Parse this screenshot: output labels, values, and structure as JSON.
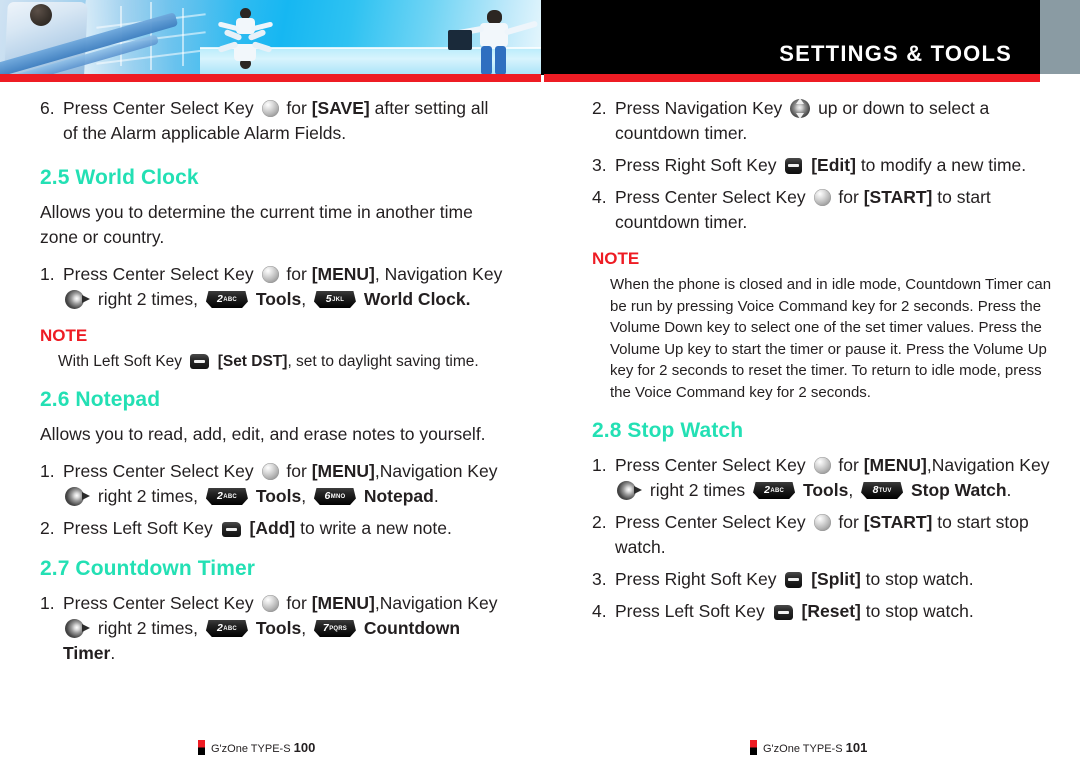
{
  "header": {
    "title": "SETTINGS & TOOLS",
    "accent_red": "#ee1c24",
    "black": "#000000",
    "gray_block": "#8a9ba3"
  },
  "theme": {
    "section_heading_color": "#23e0b4",
    "note_color": "#ee1c24",
    "body_color": "#231f20"
  },
  "left_column": {
    "item6": {
      "num": "6.",
      "t1": "Press Center Select Key",
      "icon1": "center-select-key",
      "t2": "for",
      "b1": "[SAVE]",
      "t3": "after setting all of the Alarm applicable Alarm Fields."
    },
    "s25": {
      "heading": "2.5 World Clock",
      "desc": "Allows you to determine the current time in another time zone or country.",
      "item1": {
        "num": "1.",
        "t1": "Press Center Select Key",
        "t2": "for",
        "b1": "[MENU]",
        "t3": ", Navigation Key",
        "t4": "right 2 times,",
        "key1_digit": "2",
        "key1_letters": "ABC",
        "b2": "Tools",
        "t5": ",",
        "key2_digit": "5",
        "key2_letters": "JKL",
        "b3": "World Clock",
        "t6": "."
      },
      "note": {
        "title": "NOTE",
        "t1": "With Left Soft Key",
        "icon": "left-soft-key",
        "b1": "[Set DST]",
        "t2": ", set to daylight saving time."
      }
    },
    "s26": {
      "heading": "2.6 Notepad",
      "desc": "Allows you to read, add, edit, and erase notes to yourself.",
      "item1": {
        "num": "1.",
        "t1": "Press Center Select Key",
        "t2": "for",
        "b1": "[MENU]",
        "t3": ",Navigation Key",
        "t4": "right 2 times,",
        "key1_digit": "2",
        "key1_letters": "ABC",
        "b2": "Tools",
        "t5": ",",
        "key2_digit": "6",
        "key2_letters": "MNO",
        "b3": "Notepad",
        "t6": "."
      },
      "item2": {
        "num": "2.",
        "t1": "Press Left Soft Key",
        "b1": "[Add]",
        "t2": "to write a new note."
      }
    },
    "s27": {
      "heading": "2.7 Countdown Timer",
      "item1": {
        "num": "1.",
        "t1": "Press Center Select Key",
        "t2": "for",
        "b1": "[MENU]",
        "t3": ",Navigation Key",
        "t4": "right 2 times,",
        "key1_digit": "2",
        "key1_letters": "ABC",
        "b2": "Tools",
        "t5": ",",
        "key2_digit": "7",
        "key2_letters": "PQRS",
        "b3": "Countdown Timer",
        "t6": "."
      }
    },
    "footer": {
      "brand": "G'zOne TYPE-S",
      "page": "100"
    }
  },
  "right_column": {
    "item2": {
      "num": "2.",
      "t1": "Press Navigation Key",
      "icon": "navigation-key-up-down",
      "t2": "up or down to select a countdown timer."
    },
    "item3": {
      "num": "3.",
      "t1": "Press Right Soft Key",
      "icon": "right-soft-key",
      "b1": "[Edit]",
      "t2": "to modify a new time."
    },
    "item4": {
      "num": "4.",
      "t1": "Press Center Select Key",
      "t2": "for",
      "b1": "[START]",
      "t3": "to start countdown timer."
    },
    "note": {
      "title": "NOTE",
      "body": "When the phone is closed and in idle mode, Countdown Timer can be run by pressing Voice Command key for 2 seconds.  Press the Volume Down key to select one of the set timer values.  Press the Volume Up key to start the timer or pause it.  Press the Volume Up key for 2 seconds to reset the timer.  To return to idle mode, press the Voice Command key for 2 seconds."
    },
    "s28": {
      "heading": "2.8 Stop Watch",
      "item1": {
        "num": "1.",
        "t1": "Press Center Select Key",
        "t2": "for",
        "b1": "[MENU]",
        "t3": ",Navigation Key",
        "t4": "right 2 times",
        "key1_digit": "2",
        "key1_letters": "ABC",
        "b2": "Tools",
        "t5": ",",
        "key2_digit": "8",
        "key2_letters": "TUV",
        "b3": "Stop Watch",
        "t6": "."
      },
      "item2": {
        "num": "2.",
        "t1": "Press Center Select Key",
        "t2": "for",
        "b1": "[START]",
        "t3": "to start stop watch."
      },
      "item3": {
        "num": "3.",
        "t1": "Press Right Soft Key",
        "b1": "[Split]",
        "t2": "to stop watch."
      },
      "item4": {
        "num": "4.",
        "t1": "Press Left Soft Key",
        "b1": "[Reset]",
        "t2": "to stop watch."
      }
    },
    "footer": {
      "brand": "G'zOne TYPE-S",
      "page": "101"
    }
  }
}
